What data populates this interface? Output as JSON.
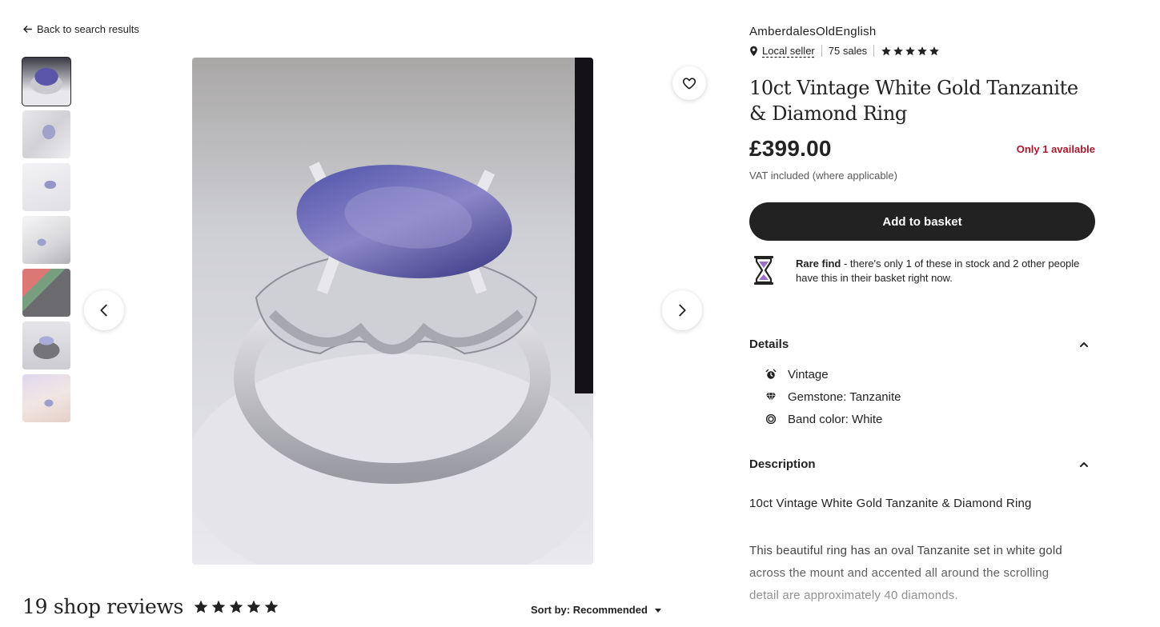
{
  "nav": {
    "back_label": "Back to search results"
  },
  "gallery": {
    "thumbnail_count": 7,
    "selected_index": 0
  },
  "shop": {
    "name": "AmberdalesOldEnglish",
    "local_seller_label": "Local seller",
    "sales": "75 sales",
    "rating_stars": 5
  },
  "listing": {
    "title": "10ct Vintage White Gold Tanzanite & Diamond Ring",
    "price": "£399.00",
    "stock": "Only 1 available",
    "vat_note": "VAT included (where applicable)",
    "add_to_basket_label": "Add to basket",
    "rare_find_label": "Rare find",
    "rare_find_text": " - there's only 1 of these in stock and 2 other people have this in their basket right now."
  },
  "details": {
    "heading": "Details",
    "items": [
      {
        "icon": "alarm-clock-icon",
        "label": "Vintage"
      },
      {
        "icon": "diamond-icon",
        "label": "Gemstone: Tanzanite"
      },
      {
        "icon": "ring-icon",
        "label": "Band color: White"
      }
    ]
  },
  "description": {
    "heading": "Description",
    "first_line": "10ct Vintage White Gold Tanzanite & Diamond Ring",
    "paragraph": "This beautiful ring has an oval Tanzanite set in white gold across the mount and accented all around the scrolling detail are approximately 40 diamonds."
  },
  "reviews": {
    "title": "19 shop reviews",
    "stars": 5,
    "sort_label": "Sort by: Recommended"
  },
  "colors": {
    "primary_button": "#222222",
    "stock_alert": "#a61a2e",
    "hourglass_accent": "#9b6fc6"
  }
}
